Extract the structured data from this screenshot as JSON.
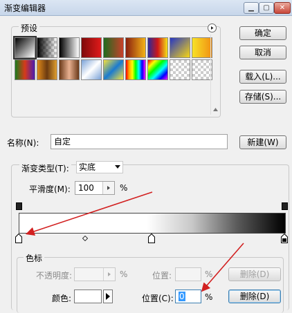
{
  "window": {
    "title": "渐变编辑器",
    "controls": [
      "minimize-icon",
      "maximize-icon",
      "close-icon"
    ]
  },
  "presets": {
    "label": "预设",
    "swatches": [
      "linear-gradient(135deg,#000,#fff)",
      "checker-black",
      "linear-gradient(90deg,#000,#fff)",
      "linear-gradient(90deg,#7d0a0a,#e01a1a)",
      "linear-gradient(90deg,#1f6b1f,#c9402a)",
      "linear-gradient(90deg,#8a1f0f,#f3b316)",
      "linear-gradient(90deg,#2a2a9a,#d01717,#f3e21a)",
      "linear-gradient(135deg,#2536c4,#f6d613)",
      "linear-gradient(90deg,#f7e227,#f19012)",
      "linear-gradient(90deg,#1b7a1b,#d63a1a,#4d1ab0)",
      "linear-gradient(90deg,#e08a1a,#6b3a10,#e0a030)",
      "linear-gradient(90deg,#6b3a1a,#e8b090,#6b3a1a)",
      "linear-gradient(135deg,#7aa2d8,#ffffff,#7aa2d8)",
      "linear-gradient(135deg,#f7e23a,#1a7ad0,#f7e23a)",
      "linear-gradient(90deg,red,orange,yellow,lime,cyan,blue,magenta)",
      "linear-gradient(135deg,red,yellow,lime,cyan,blue,magenta)",
      "checker",
      "checker"
    ]
  },
  "buttons": {
    "ok": "确定",
    "cancel": "取消",
    "load": "载入(L)...",
    "save": "存储(S)...",
    "new": "新建(W)"
  },
  "name": {
    "label": "名称(N):",
    "value": "自定"
  },
  "gradient_type": {
    "label": "渐变类型(T):",
    "value": "实底"
  },
  "smoothness": {
    "label": "平滑度(M):",
    "value": "100",
    "unit": "%"
  },
  "color_stops": {
    "label": "色标",
    "opacity_label": "不透明度:",
    "opacity_unit": "%",
    "position_label": "位置:",
    "position_unit": "%",
    "delete_label": "删除(D)",
    "color_label": "颜色:",
    "color_position_label": "位置(C):",
    "color_position_value": "0",
    "color_position_unit": "%",
    "color_delete_label": "删除(D)"
  },
  "gradient_stops": {
    "opacity_positions": [
      0,
      100
    ],
    "color_positions": [
      0,
      50,
      100
    ],
    "midpoint": 25
  },
  "colors": {
    "arrow": "#d22020",
    "stop_fill": "#000000"
  },
  "icons": {
    "menu": "circle-arrow-icon",
    "dropdown": "dropdown-arrow-icon",
    "stepper": "stepper-arrow-icon"
  }
}
